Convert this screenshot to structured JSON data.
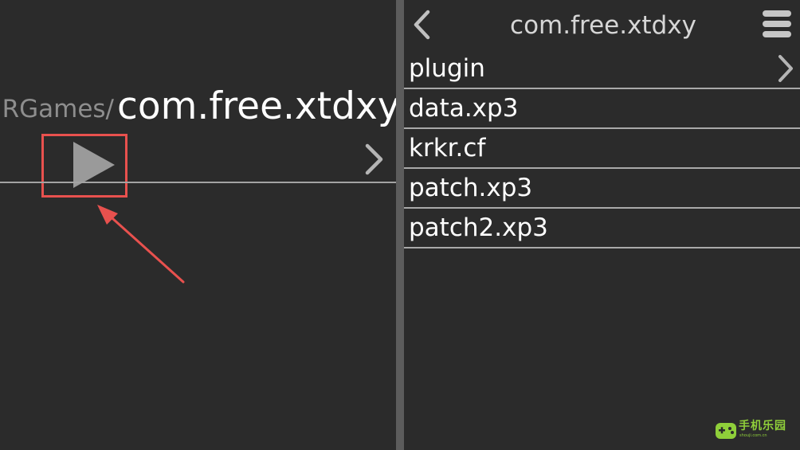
{
  "left_pane": {
    "path_prefix": "RGames/",
    "current_folder": "com.free.xtdxy",
    "play_button": {
      "icon": "play-icon"
    },
    "nav_chevron": {
      "icon": "chevron-right-icon"
    }
  },
  "annotation": {
    "highlight_color": "#e8514e"
  },
  "right_pane": {
    "title": "com.free.xtdxy",
    "back_icon": "chevron-left-icon",
    "menu_icon": "hamburger-menu-icon",
    "files": [
      {
        "label": "plugin",
        "is_folder": true
      },
      {
        "label": "data.xp3",
        "is_folder": false
      },
      {
        "label": "krkr.cf",
        "is_folder": false
      },
      {
        "label": "patch.xp3",
        "is_folder": false
      },
      {
        "label": "patch2.xp3",
        "is_folder": false
      }
    ]
  },
  "watermark": {
    "text": "手机乐园",
    "subtext": "shouji.com.cn",
    "color": "#8fcf3a"
  },
  "colors": {
    "background": "#2b2b2b",
    "split_bar": "#5c5c5c",
    "divider": "#a9a9a9"
  }
}
